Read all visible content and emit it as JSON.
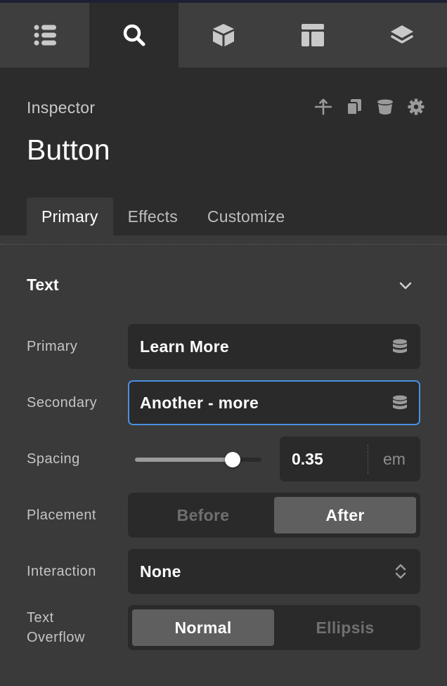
{
  "topbar": {
    "icons": [
      "list-icon",
      "search-icon",
      "cube-icon",
      "layout-icon",
      "layers-icon"
    ],
    "active": "search-icon"
  },
  "header": {
    "label": "Inspector",
    "title": "Button",
    "actions": [
      "move-up-icon",
      "duplicate-icon",
      "delete-icon",
      "settings-icon"
    ]
  },
  "tabs": [
    {
      "label": "Primary",
      "active": true
    },
    {
      "label": "Effects",
      "active": false
    },
    {
      "label": "Customize",
      "active": false
    }
  ],
  "section": {
    "title": "Text",
    "expanded": true
  },
  "fields": {
    "primary": {
      "label": "Primary",
      "value": "Learn More"
    },
    "secondary": {
      "label": "Secondary",
      "value": "Another - more"
    },
    "spacing": {
      "label": "Spacing",
      "value": "0.35",
      "unit": "em",
      "slider_fraction": 0.77
    },
    "placement": {
      "label": "Placement",
      "options": [
        "Before",
        "After"
      ],
      "selected": "After"
    },
    "interaction": {
      "label": "Interaction",
      "value": "None"
    },
    "text_overflow": {
      "label_line1": "Text",
      "label_line2": "Overflow",
      "options": [
        "Normal",
        "Ellipsis"
      ],
      "selected": "Normal"
    }
  },
  "colors": {
    "panel": "#3a3a3a",
    "header": "#2c2c2c",
    "field": "#2a2a2a",
    "focus": "#4a90e2",
    "selected_segment": "#5f5f5f"
  }
}
